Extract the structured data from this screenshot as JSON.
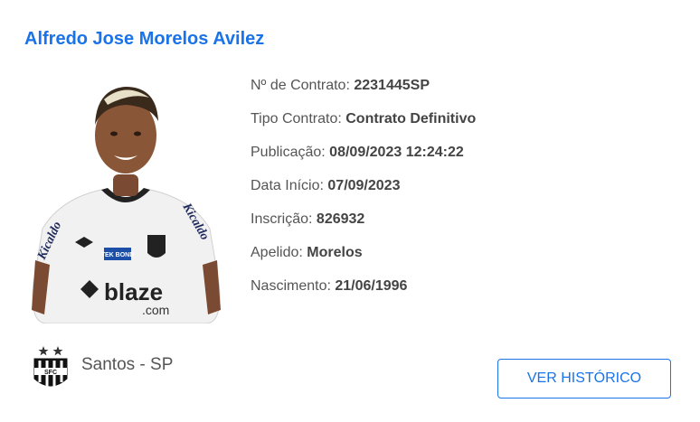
{
  "player": {
    "name": "Alfredo Jose Morelos Avilez",
    "photo_icon": "player-photo",
    "shirt_text": {
      "sponsor_brand": "blaze",
      "sponsor_domain": ".com",
      "sleeve_name": "Kicaldo",
      "chest_sponsor": "TEK BOND"
    }
  },
  "details": [
    {
      "label": "Nº de Contrato:",
      "value": "2231445SP"
    },
    {
      "label": "Tipo Contrato:",
      "value": "Contrato Definitivo"
    },
    {
      "label": "Publicação:",
      "value": "08/09/2023 12:24:22"
    },
    {
      "label": "Data Início:",
      "value": "07/09/2023"
    },
    {
      "label": "Inscrição:",
      "value": "826932"
    },
    {
      "label": "Apelido:",
      "value": "Morelos"
    },
    {
      "label": "Nascimento:",
      "value": "21/06/1996"
    }
  ],
  "club": {
    "name": "Santos - SP",
    "crest_icon": "santos-crest-icon"
  },
  "actions": {
    "history_button": "VER HISTÓRICO"
  },
  "colors": {
    "accent": "#1a73e8",
    "text": "#555555"
  }
}
